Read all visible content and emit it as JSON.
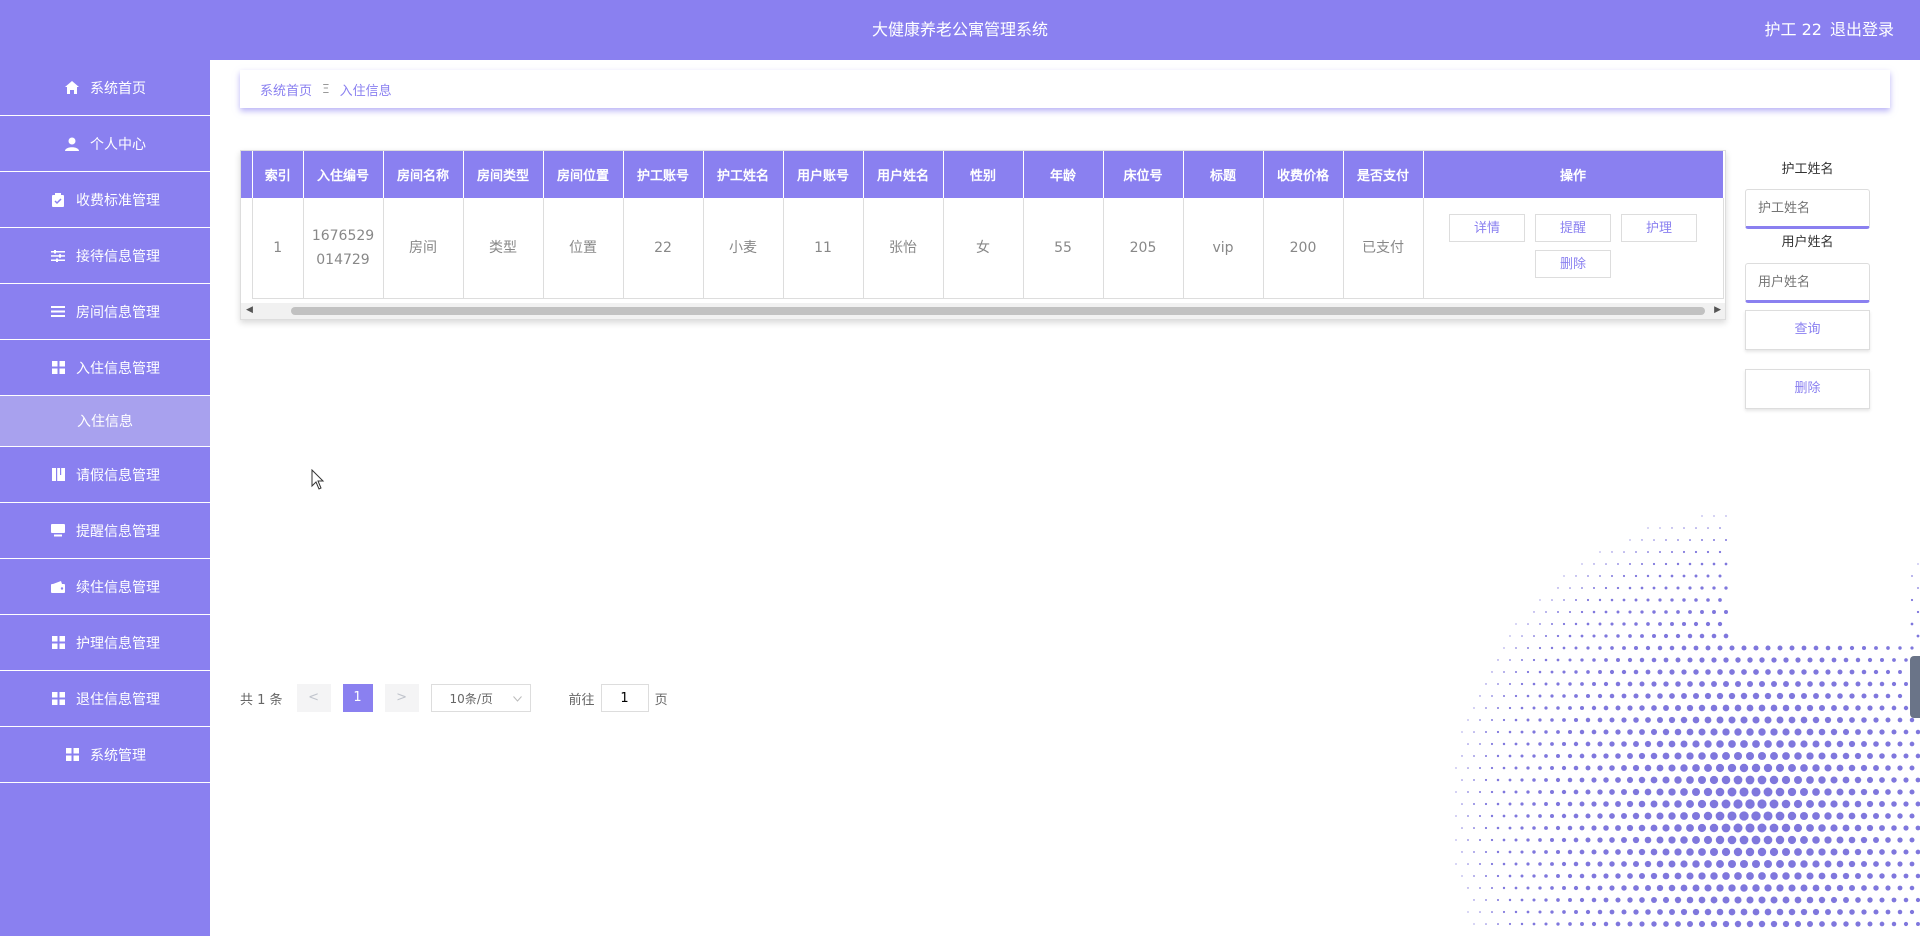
{
  "app": {
    "title": "大健康养老公寓管理系统",
    "user_label": "护工 22",
    "logout": "退出登录"
  },
  "colors": {
    "primary": "#8a80f0",
    "sidebar_active": "#a8a1ee"
  },
  "sidebar": {
    "items": [
      {
        "label": "系统首页",
        "icon": "home-icon"
      },
      {
        "label": "个人中心",
        "icon": "user-icon"
      },
      {
        "label": "收费标准管理",
        "icon": "clipboard-icon"
      },
      {
        "label": "接待信息管理",
        "icon": "sliders-icon"
      },
      {
        "label": "房间信息管理",
        "icon": "list-icon"
      },
      {
        "label": "入住信息管理",
        "icon": "grid-icon"
      }
    ],
    "active_sub": "入住信息",
    "items2": [
      {
        "label": "请假信息管理",
        "icon": "book-icon"
      },
      {
        "label": "提醒信息管理",
        "icon": "monitor-icon"
      },
      {
        "label": "续住信息管理",
        "icon": "wallet-icon"
      },
      {
        "label": "护理信息管理",
        "icon": "grid-icon"
      },
      {
        "label": "退住信息管理",
        "icon": "grid-icon"
      },
      {
        "label": "系统管理",
        "icon": "grid-icon"
      }
    ]
  },
  "breadcrumb": {
    "home": "系统首页",
    "sep": "Ξ",
    "current": "入住信息"
  },
  "table": {
    "headers": [
      "索引",
      "入住编号",
      "房间名称",
      "房间类型",
      "房间位置",
      "护工账号",
      "护工姓名",
      "用户账号",
      "用户姓名",
      "性别",
      "年龄",
      "床位号",
      "标题",
      "收费价格",
      "是否支付",
      "操作"
    ],
    "rows": [
      {
        "index": "1",
        "checkin_no_line1": "1676529",
        "checkin_no_line2": "014729",
        "room_name": "房间",
        "room_type": "类型",
        "room_location": "位置",
        "nurse_account": "22",
        "nurse_name": "小麦",
        "user_account": "11",
        "user_name": "张怡",
        "gender": "女",
        "age": "55",
        "bed_no": "205",
        "title": "vip",
        "price": "200",
        "paid": "已支付"
      }
    ],
    "actions": {
      "detail": "详情",
      "remind": "提醒",
      "care": "护理",
      "delete": "删除"
    }
  },
  "filter": {
    "nurse_label": "护工姓名",
    "nurse_placeholder": "护工姓名",
    "user_label": "用户姓名",
    "user_placeholder": "用户姓名",
    "search": "查询",
    "delete": "删除"
  },
  "pagination": {
    "total": "共 1 条",
    "prev": "<",
    "page": "1",
    "next": ">",
    "size": "10条/页",
    "goto_prefix": "前往",
    "goto_value": "1",
    "goto_suffix": "页"
  }
}
